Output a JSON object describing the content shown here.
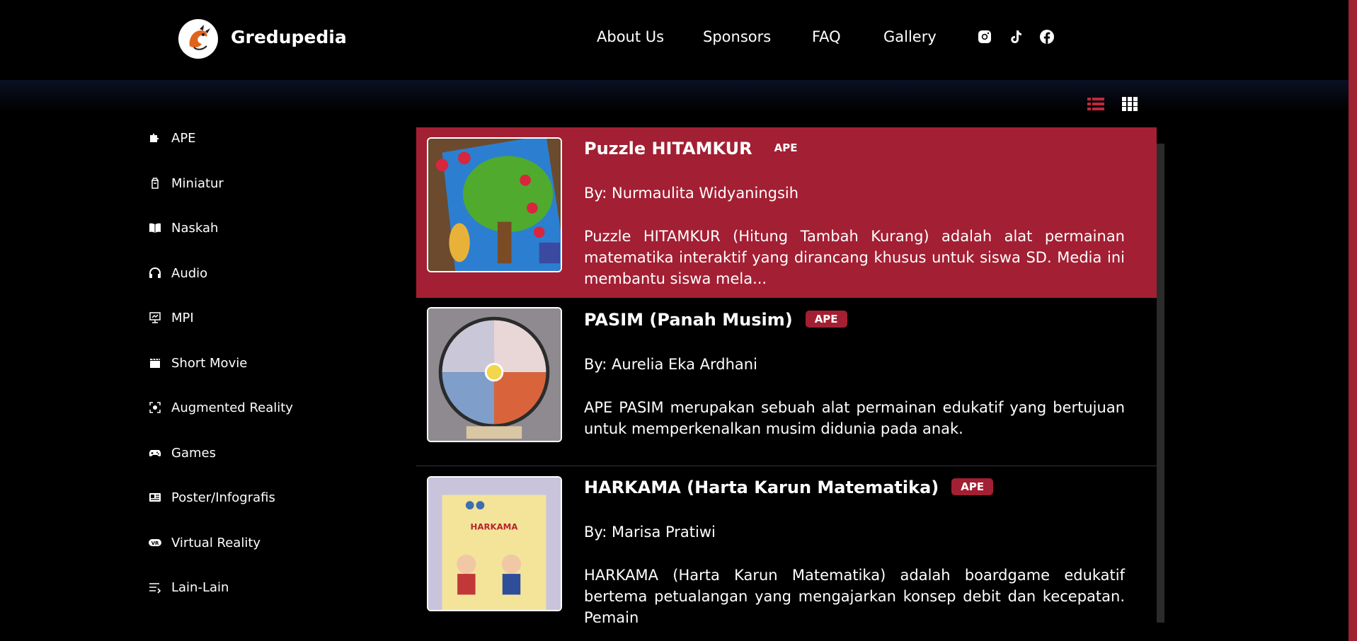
{
  "header": {
    "brand": "Gredupedia",
    "nav": [
      "About Us",
      "Sponsors",
      "FAQ",
      "Gallery"
    ],
    "social_icons": [
      "instagram-icon",
      "tiktok-icon",
      "facebook-icon"
    ]
  },
  "view_toggles": [
    "list-view-icon",
    "grid-view-icon"
  ],
  "sidebar": {
    "items": [
      {
        "label": "APE",
        "icon": "puzzle-icon"
      },
      {
        "label": "Miniatur",
        "icon": "lantern-icon"
      },
      {
        "label": "Naskah",
        "icon": "book-icon"
      },
      {
        "label": "Audio",
        "icon": "headphones-icon"
      },
      {
        "label": "MPI",
        "icon": "monitor-icon"
      },
      {
        "label": "Short Movie",
        "icon": "clapperboard-icon"
      },
      {
        "label": "Augmented Reality",
        "icon": "ar-icon"
      },
      {
        "label": "Games",
        "icon": "gamepad-icon"
      },
      {
        "label": "Poster/Infografis",
        "icon": "poster-icon"
      },
      {
        "label": "Virtual Reality",
        "icon": "vr-icon"
      },
      {
        "label": "Lain-Lain",
        "icon": "list-more-icon"
      }
    ]
  },
  "items": [
    {
      "title": "Puzzle HITAMKUR",
      "badge": "APE",
      "author": "By: Nurmaulita Widyaningsih",
      "description": "Puzzle HITAMKUR (Hitung Tambah Kurang) adalah alat permainan matematika interaktif yang dirancang khusus untuk siswa SD. Media ini membantu siswa mela...",
      "active": true
    },
    {
      "title": "PASIM (Panah Musim)",
      "badge": "APE",
      "author": "By: Aurelia Eka Ardhani",
      "description": "APE PASIM merupakan sebuah alat permainan edukatif yang bertujuan untuk memperkenalkan musim didunia pada anak.",
      "active": false
    },
    {
      "title": "HARKAMA (Harta Karun Matematika)",
      "badge": "APE",
      "author": "By: Marisa Pratiwi",
      "description": "HARKAMA (Harta Karun Matematika) adalah boardgame edukatif bertema petualangan yang mengajarkan konsep debit dan kecepatan. Pemain",
      "active": false,
      "thumb_text": "HARKAMA"
    }
  ],
  "colors": {
    "accent": "#a31f33",
    "background": "#000000"
  }
}
